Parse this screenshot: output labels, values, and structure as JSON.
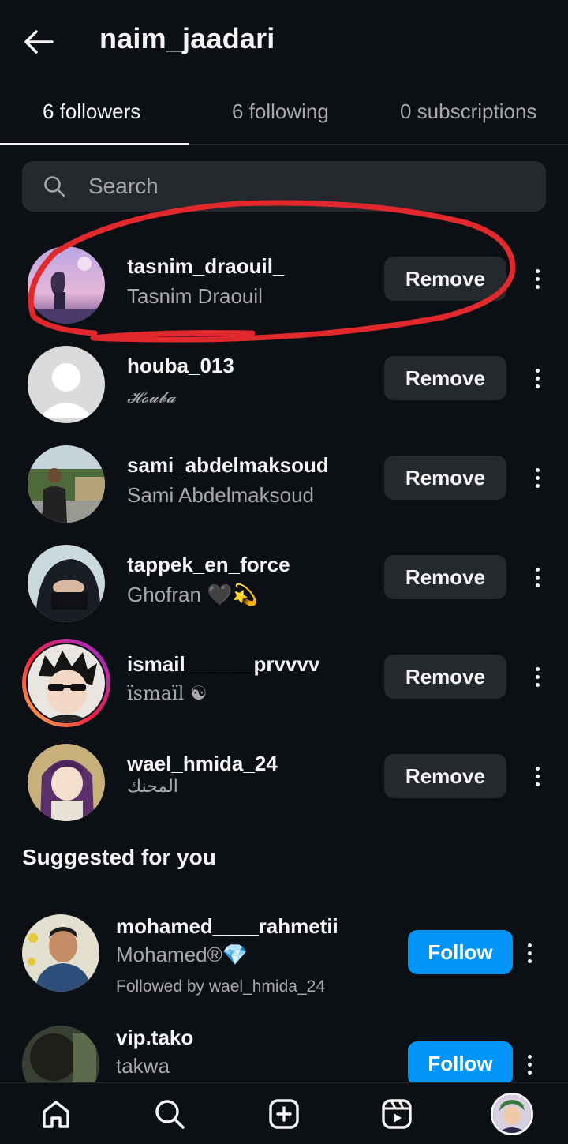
{
  "header": {
    "title": "naim_jaadari",
    "back_icon": "arrow-left-icon"
  },
  "tabs": [
    {
      "label": "6 followers",
      "active": true
    },
    {
      "label": "6 following",
      "active": false
    },
    {
      "label": "0 subscriptions",
      "active": false
    }
  ],
  "search": {
    "placeholder": "Search",
    "value": ""
  },
  "followers": [
    {
      "username": "tasnim_draouil_",
      "fullname": "Tasnim Draouil",
      "button": "Remove"
    },
    {
      "username": "houba_013",
      "fullname": "𝓗𝓸𝓾𝓫𝓪",
      "button": "Remove"
    },
    {
      "username": "sami_abdelmaksoud",
      "fullname": "Sami Abdelmaksoud",
      "button": "Remove"
    },
    {
      "username": "tappek_en_force",
      "fullname": "Ghofran 🖤💫",
      "button": "Remove"
    },
    {
      "username": "ismail______prvvvv",
      "fullname": "ïsmaïl ☯",
      "button": "Remove"
    },
    {
      "username": "wael_hmida_24",
      "fullname": "المحنك",
      "button": "Remove"
    }
  ],
  "suggested": {
    "title": "Suggested for you",
    "items": [
      {
        "username": "mohamed____rahmetii",
        "fullname": "Mohamed®💎",
        "mutual": "Followed by wael_hmida_24",
        "button": "Follow"
      },
      {
        "username": "vip.tako",
        "fullname": "takwa",
        "mutual": "",
        "button": "Follow"
      }
    ]
  },
  "bottom_nav": [
    "home-icon",
    "search-icon",
    "create-icon",
    "reels-icon",
    "profile-avatar"
  ],
  "colors": {
    "background": "#0c1014",
    "button": "#25292e",
    "follow": "#0095f6",
    "annotation": "#e0282d"
  }
}
